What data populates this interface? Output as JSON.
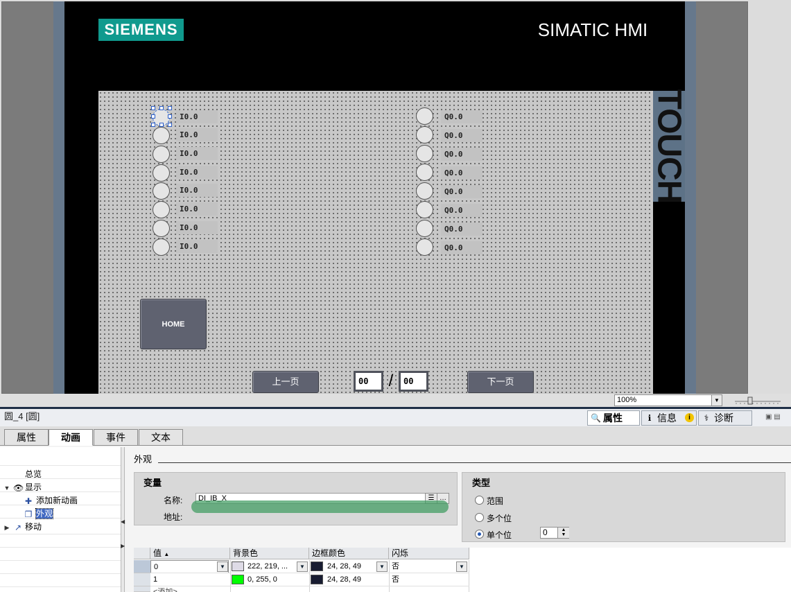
{
  "hmi": {
    "brand": "SIEMENS",
    "product": "SIMATIC HMI",
    "touch_label": "TOUCH",
    "inputs": [
      "I0.0",
      "I0.0",
      "I0.0",
      "I0.0",
      "I0.0",
      "I0.0",
      "I0.0",
      "I0.0"
    ],
    "outputs": [
      "Q0.0",
      "Q0.0",
      "Q0.0",
      "Q0.0",
      "Q0.0",
      "Q0.0",
      "Q0.0",
      "Q0.0"
    ],
    "home_button": "HOME",
    "prev_page_button": "上一页",
    "next_page_button": "下一页",
    "current_page": "00",
    "page_separator": "/",
    "total_pages": "00"
  },
  "editor_status": {
    "zoom": "100%"
  },
  "inspector": {
    "object_title": "圆_4 [圆]",
    "top_tabs": [
      {
        "label": "属性",
        "icon": "properties-icon"
      },
      {
        "label": "信息",
        "icon": "info-icon"
      },
      {
        "label": "诊断",
        "icon": "diagnostics-icon"
      }
    ],
    "sub_tabs": [
      "属性",
      "动画",
      "事件",
      "文本"
    ],
    "active_sub_tab": "动画",
    "tree": {
      "overview": "总览",
      "display": "显示",
      "add_animation": "添加新动画",
      "appearance": "外观",
      "movement": "移动"
    },
    "section_title": "外观",
    "variable_group": {
      "title": "变量",
      "name_label": "名称:",
      "name_value": "DI_IB_X",
      "address_label": "地址:"
    },
    "type_group": {
      "title": "类型",
      "options": [
        "范围",
        "多个位",
        "单个位"
      ],
      "selected": "单个位",
      "bit_value": "0"
    },
    "table": {
      "headers": [
        "值",
        "背景色",
        "边框颜色",
        "闪烁"
      ],
      "rows": [
        {
          "value": "0",
          "bg": "222, 219, ...",
          "bg_color": "#dedbe6",
          "border": "24, 28, 49",
          "border_color": "#181c31",
          "blink": "否"
        },
        {
          "value": "1",
          "bg": "0, 255, 0",
          "bg_color": "#00ff00",
          "border": "24, 28, 49",
          "border_color": "#181c31",
          "blink": "否"
        }
      ],
      "add_label": "<添加>"
    }
  }
}
